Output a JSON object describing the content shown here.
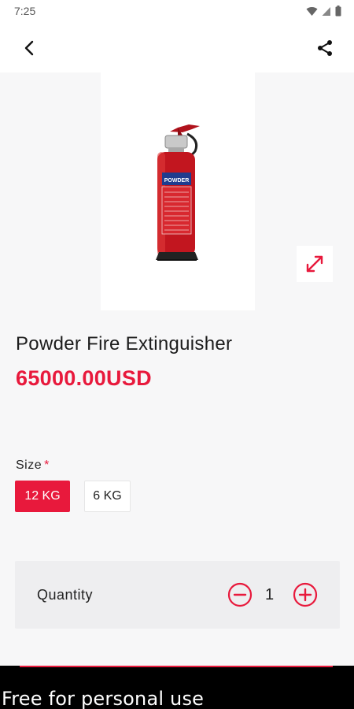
{
  "status_bar": {
    "time": "7:25"
  },
  "product": {
    "title": "Powder Fire Extinguisher",
    "price": "65000.00USD",
    "image_label": "POWDER"
  },
  "size": {
    "label": "Size",
    "required_mark": "*",
    "options": [
      {
        "label": "12 KG",
        "selected": true
      },
      {
        "label": "6 KG",
        "selected": false
      }
    ]
  },
  "quantity": {
    "label": "Quantity",
    "value": "1"
  },
  "watermark": "Free for personal use",
  "colors": {
    "accent": "#e8193c",
    "background": "#f7f7f8",
    "footer": "#000000"
  },
  "icons": [
    "back-arrow-icon",
    "share-icon",
    "expand-icon",
    "minus-circle-icon",
    "plus-circle-icon",
    "wifi-icon",
    "signal-icon",
    "battery-icon"
  ]
}
